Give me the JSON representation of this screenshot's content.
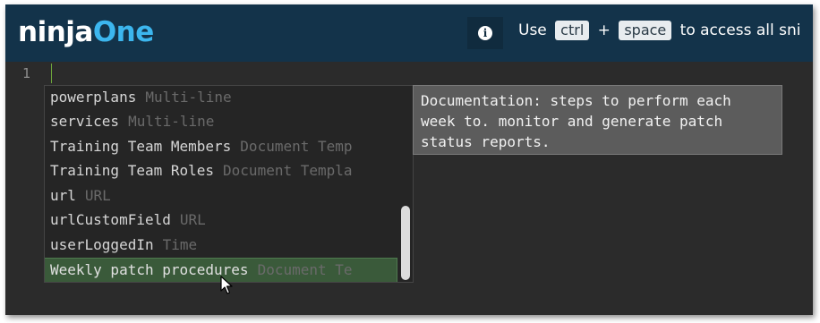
{
  "brand": {
    "logo_part1": "ninja",
    "logo_part2": "One"
  },
  "header": {
    "info_icon": "info-icon",
    "hint_use": "Use",
    "hint_key1": "ctrl",
    "hint_plus": "+",
    "hint_key2": "space",
    "hint_rest": "to access all sni"
  },
  "editor": {
    "line_number": "1"
  },
  "suggestions": {
    "items": [
      {
        "label": "powerplans",
        "type": "Multi-line"
      },
      {
        "label": "services",
        "type": "Multi-line"
      },
      {
        "label": "Training Team Members",
        "type": "Document Temp"
      },
      {
        "label": "Training Team Roles",
        "type": "Document Templa"
      },
      {
        "label": "url",
        "type": "URL"
      },
      {
        "label": "urlCustomField",
        "type": "URL"
      },
      {
        "label": "userLoggedIn",
        "type": "Time"
      },
      {
        "label": "Weekly patch procedures",
        "type": "Document Te"
      }
    ],
    "selected_index": 7
  },
  "documentation": {
    "text": "Documentation: steps to perform each\nweek to. monitor and generate patch\nstatus reports."
  },
  "colors": {
    "header_bg": "#13334a",
    "accent": "#3cb6ee",
    "editor_bg": "#2b2b2b",
    "selected_bg": "#3a5a3a"
  }
}
